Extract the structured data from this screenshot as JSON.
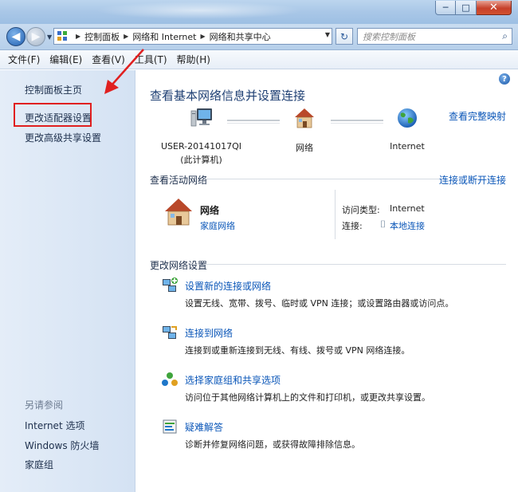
{
  "window": {
    "minimize_glyph": "─",
    "maximize_glyph": "□",
    "close_glyph": "✕"
  },
  "address": {
    "crumbs": [
      "控制面板",
      "网络和 Internet",
      "网络和共享中心"
    ],
    "search_placeholder": "搜索控制面板"
  },
  "menu": [
    "文件(F)",
    "编辑(E)",
    "查看(V)",
    "工具(T)",
    "帮助(H)"
  ],
  "sidebar": {
    "items": [
      "控制面板主页",
      "更改适配器设置",
      "更改高级共享设置"
    ],
    "see_also_label": "另请参阅",
    "see_also": [
      "Internet 选项",
      "Windows 防火墙",
      "家庭组"
    ]
  },
  "main": {
    "title": "查看基本网络信息并设置连接",
    "view_full_map": "查看完整映射",
    "map_nodes": [
      {
        "line1": "USER-20141017QI",
        "line2": "(此计算机)",
        "icon": "computer-icon"
      },
      {
        "line1": "网络",
        "line2": "",
        "icon": "house-icon"
      },
      {
        "line1": "Internet",
        "line2": "",
        "icon": "globe-icon"
      }
    ],
    "active_networks_heading": "查看活动网络",
    "connect_disconnect": "连接或断开连接",
    "network": {
      "name": "网络",
      "type": "家庭网络",
      "access_type_label": "访问类型:",
      "access_type_value": "Internet",
      "connection_label": "连接:",
      "connection_value": "本地连接"
    },
    "change_settings_heading": "更改网络设置",
    "tasks": [
      {
        "title": "设置新的连接或网络",
        "desc": "设置无线、宽带、拨号、临时或 VPN 连接；或设置路由器或访问点。",
        "icon": "new-connection-icon"
      },
      {
        "title": "连接到网络",
        "desc": "连接到或重新连接到无线、有线、拨号或 VPN 网络连接。",
        "icon": "connect-network-icon"
      },
      {
        "title": "选择家庭组和共享选项",
        "desc": "访问位于其他网络计算机上的文件和打印机，或更改共享设置。",
        "icon": "homegroup-icon"
      },
      {
        "title": "疑难解答",
        "desc": "诊断并修复网络问题，或获得故障排除信息。",
        "icon": "troubleshoot-icon"
      }
    ]
  },
  "colors": {
    "link": "#0a56b8",
    "title": "#1e3f73",
    "annotation": "#e02020"
  }
}
